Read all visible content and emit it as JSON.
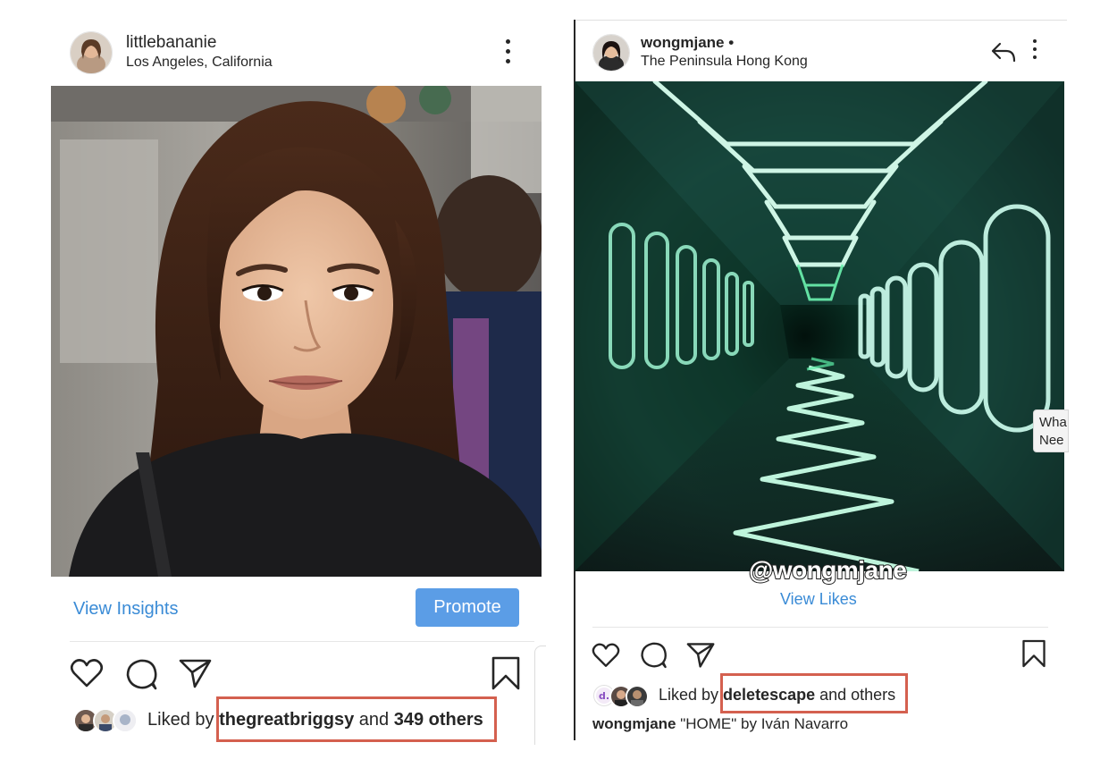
{
  "left_post": {
    "username": "littlebananie",
    "location": "Los Angeles, California",
    "view_insights_label": "View Insights",
    "promote_label": "Promote",
    "likes": {
      "prefix": "Liked by ",
      "user": "thegreatbriggsy",
      "middle": " and ",
      "count": "349 others"
    }
  },
  "right_post": {
    "username": "wongmjane •",
    "location": "The Peninsula Hong Kong",
    "image_watermark": "@wongmjane",
    "view_likes_label": "View Likes",
    "popup_lines": [
      "Wha",
      "Nee"
    ],
    "likes": {
      "prefix": "Liked by ",
      "user": "deletescape",
      "suffix": " and others"
    },
    "caption": {
      "user": "wongmjane",
      "text": " \"HOME\" by Iván Navarro"
    }
  },
  "icons": {
    "like": "heart-icon",
    "comment": "comment-icon",
    "share": "paper-plane-icon",
    "save": "bookmark-icon",
    "more": "more-vertical-icon",
    "reply": "reply-arrow-icon"
  },
  "colors": {
    "link_blue": "#3a8bd6",
    "promote_button": "#5b9de6",
    "highlight_border": "#d4604f",
    "text": "#262626"
  }
}
